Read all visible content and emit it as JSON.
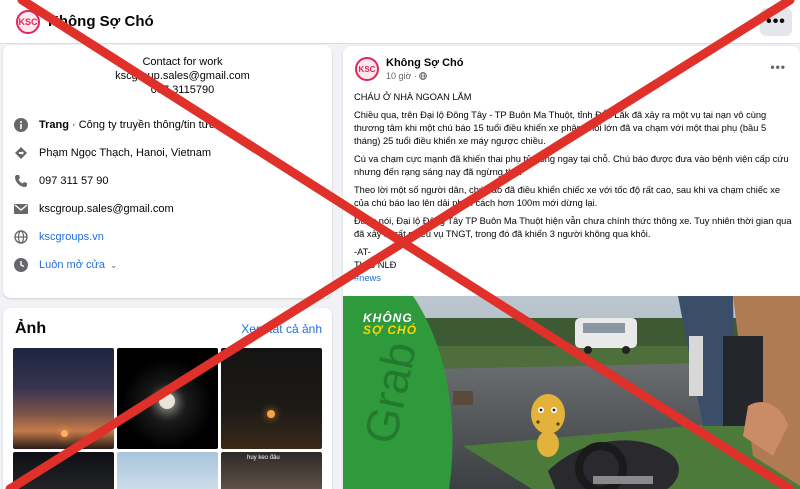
{
  "header": {
    "page_name": "Không Sợ Chó",
    "more": "•••"
  },
  "intro": {
    "contact_line1": "Contact for work",
    "contact_line2": "kscgroup.sales@gmail.com",
    "contact_line3": "097 3115790",
    "category_label": "Trang",
    "category_value": " · Công ty truyền thông/tin tức",
    "address": "Phạm Ngọc Thạch, Hanoi, Vietnam",
    "phone": "097 311 57 90",
    "email": "kscgroup.sales@gmail.com",
    "website": "kscgroups.vn",
    "hours": "Luôn mở cửa"
  },
  "photos": {
    "title": "Ảnh",
    "see_all": "Xem tất cả ảnh",
    "caption": "huy keo đâu"
  },
  "post": {
    "author": "Không Sợ Chó",
    "time": "10 giờ ·",
    "more": "•••",
    "headline": "CHÁU Ở NHÀ NGOAN LẮM",
    "p1": "Chiều qua, trên Đại lộ Đông Tây - TP Buôn Ma Thuột, tỉnh Đắk Lắk đã xảy ra một vụ tai nạn vô cùng thương tâm khi một chú báo 15 tuổi điều khiển xe phân khối lớn đã va chạm với một thai phụ (bầu 5 tháng) 25 tuổi điều khiển xe máy ngược chiều.",
    "p2": "Cú va chạm cực mạnh đã khiến thai phụ tử vong ngay tại chỗ. Chú báo được đưa vào bệnh viện cấp cứu nhưng đến rạng sáng nay đã ngừng thở.",
    "p3": "Theo lời một số người dân, chú báo đã điều khiển chiếc xe với tốc độ rất cao, sau khi va chạm chiếc xe của chú báo lao lên dải phân cách hơn 100m mới dừng lại.",
    "p4": "Đáng nói, Đại lộ Đông Tây TP Buôn Ma Thuột hiện vẫn chưa chính thức thông xe. Tuy nhiên thời gian qua đã xảy ra rất nhiều vụ TNGT, trong đó đã khiến 3 người không qua khỏi.",
    "sig1": "-AT-",
    "sig2": "Theo NLĐ",
    "hashtag": "#news"
  },
  "watermark": {
    "line1": "KHÔNG",
    "line2": "SỢ CHÓ"
  },
  "overlay": {
    "color": "#e0302a"
  }
}
